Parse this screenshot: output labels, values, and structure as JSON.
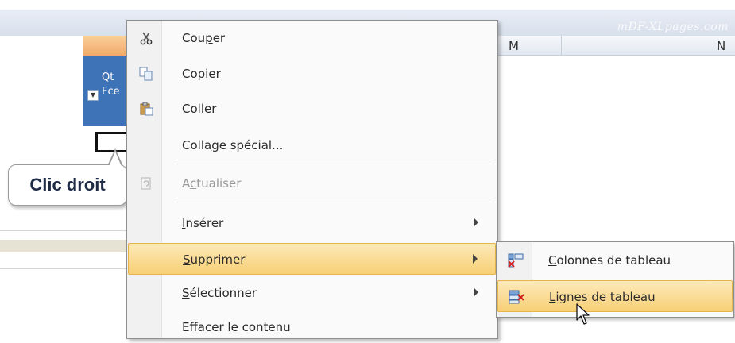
{
  "watermark": "mDF-XLpages.com",
  "columns": [
    "M",
    "N"
  ],
  "table_header": {
    "line1": "Qt",
    "line2": "Fce"
  },
  "callout": "Clic droit",
  "menu": {
    "items": [
      {
        "pre": "Cou",
        "key": "p",
        "post": "er",
        "icon": "scissors-icon",
        "disabled": false,
        "submenu": false
      },
      {
        "pre": "",
        "key": "C",
        "post": "opier",
        "icon": "copy-icon",
        "disabled": false,
        "submenu": false
      },
      {
        "pre": "C",
        "key": "o",
        "post": "ller",
        "icon": "paste-icon",
        "disabled": false,
        "submenu": false
      },
      {
        "pre": "Colla",
        "key": "g",
        "post": "e spécial...",
        "icon": "",
        "disabled": false,
        "submenu": false
      },
      {
        "pre": "A",
        "key": "c",
        "post": "tualiser",
        "icon": "refresh-icon",
        "disabled": true,
        "submenu": false
      },
      {
        "pre": "",
        "key": "I",
        "post": "nsérer",
        "icon": "",
        "disabled": false,
        "submenu": true
      },
      {
        "pre": "",
        "key": "S",
        "post": "upprimer",
        "icon": "",
        "disabled": false,
        "submenu": true,
        "highlighted": true
      },
      {
        "pre": "",
        "key": "S",
        "post": "électionner",
        "icon": "",
        "disabled": false,
        "submenu": true
      },
      {
        "pre": "Effacer le contenu",
        "key": "",
        "post": "",
        "icon": "",
        "disabled": false,
        "submenu": false
      }
    ]
  },
  "submenu": {
    "items": [
      {
        "pre": "",
        "key": "C",
        "post": "olonnes de tableau",
        "icon": "delete-columns-icon"
      },
      {
        "pre": "",
        "key": "L",
        "post": "ignes de tableau",
        "icon": "delete-rows-icon",
        "highlighted": true
      }
    ]
  },
  "colors": {
    "highlight_top": "#fde9b9",
    "highlight_bottom": "#f7d076",
    "table_header_blue": "#3f73b7",
    "column_header_orange": "#f2a868"
  }
}
